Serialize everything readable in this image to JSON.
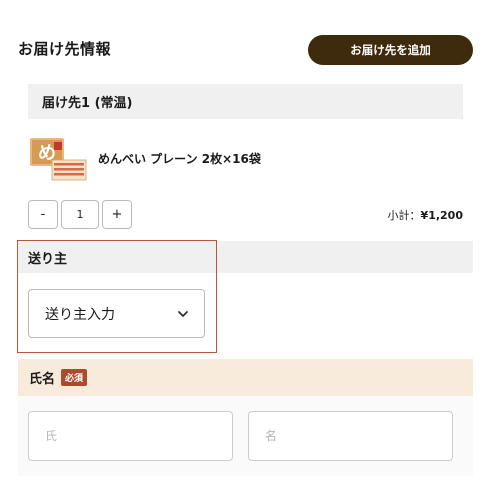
{
  "header": {
    "title": "お届け先情報",
    "add_button": "お届け先を追加"
  },
  "destination": {
    "label": "届け先1 (常温)",
    "product": {
      "name": "めんべい プレーン 2枚×16袋",
      "image_icon": "menbei-product-box-icon"
    },
    "quantity": {
      "minus": "-",
      "value": "1",
      "plus": "+"
    },
    "subtotal": {
      "label": "小計：",
      "amount": "¥1,200"
    }
  },
  "sender": {
    "label": "送り主",
    "select_value": "送り主入力"
  },
  "name": {
    "label": "氏名",
    "required": "必須",
    "last_placeholder": "氏",
    "first_placeholder": "名"
  },
  "colors": {
    "button_bg": "#3e2a0c",
    "highlight_border": "#b45a3c",
    "required_badge": "#a84b2e",
    "name_header_bg": "#f9ebdb"
  }
}
